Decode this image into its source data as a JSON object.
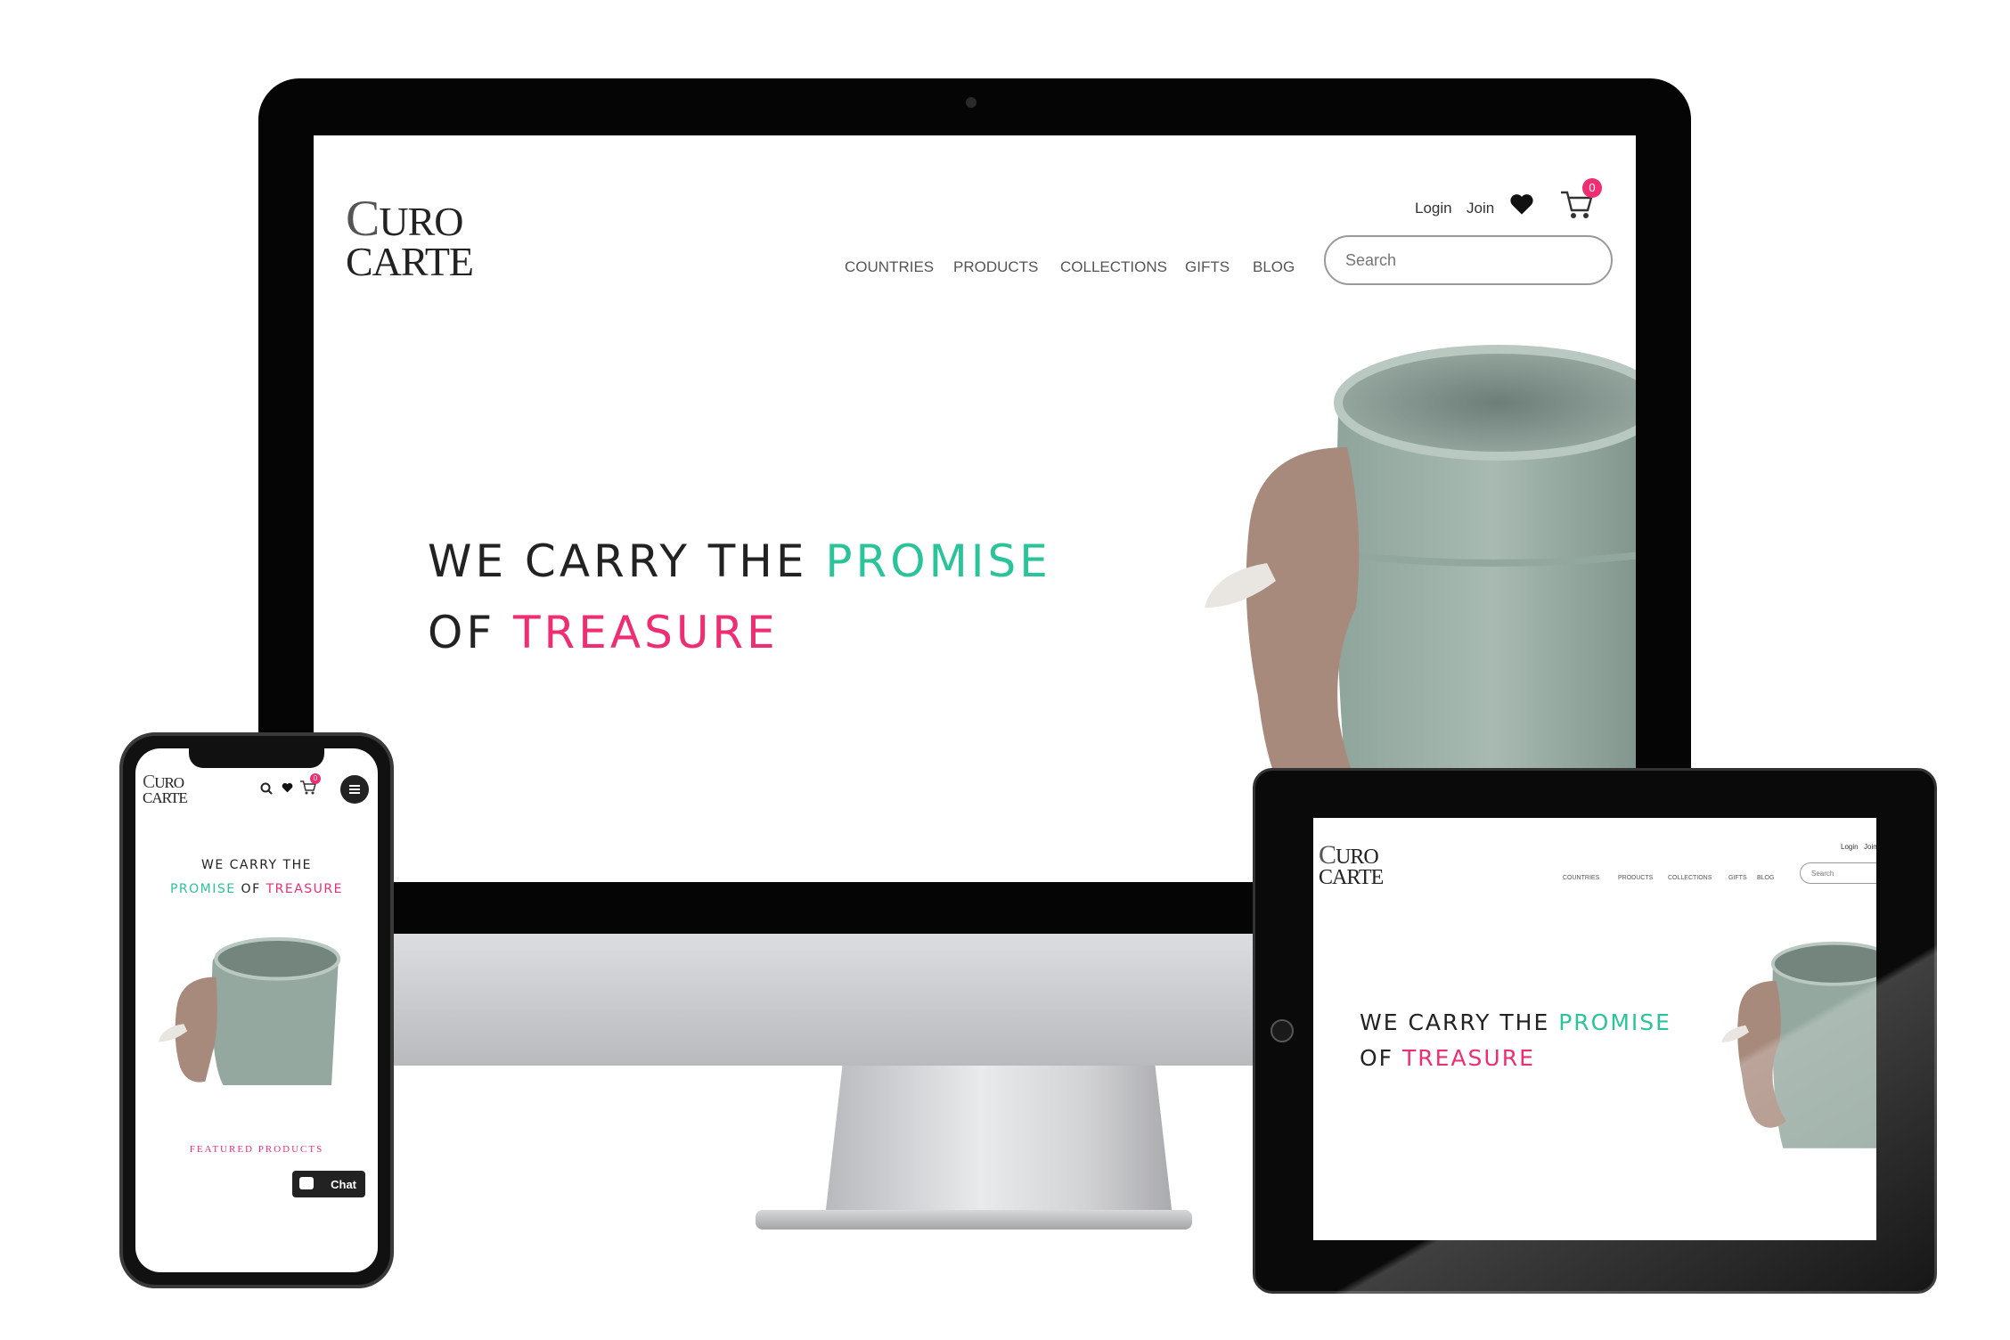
{
  "brand": {
    "line1": "CURO",
    "line2": "CARTE",
    "c_initial": "C",
    "rest1": "URO"
  },
  "nav": [
    "COUNTRIES",
    "PRODUCTS",
    "COLLECTIONS",
    "GIFTS",
    "BLOG"
  ],
  "header": {
    "login": "Login",
    "join": "Join",
    "cart_count": "0",
    "search_placeholder": "Search"
  },
  "hero": {
    "line1_prefix": "WE CARRY THE ",
    "highlight1": "PROMISE",
    "line2_prefix": "OF ",
    "highlight2": "TREASURE"
  },
  "mobile": {
    "line1": "WE CARRY THE",
    "promise": "PROMISE",
    "of": " OF ",
    "treasure": "TREASURE",
    "featured": "FEATURED PRODUCTS",
    "chat": "Chat"
  },
  "colors": {
    "accent_teal": "#2bc49a",
    "accent_pink": "#ee2d73",
    "bezel": "#050505"
  },
  "icons": [
    "heart-icon",
    "cart-icon",
    "search-icon",
    "menu-icon",
    "chat-icon"
  ]
}
